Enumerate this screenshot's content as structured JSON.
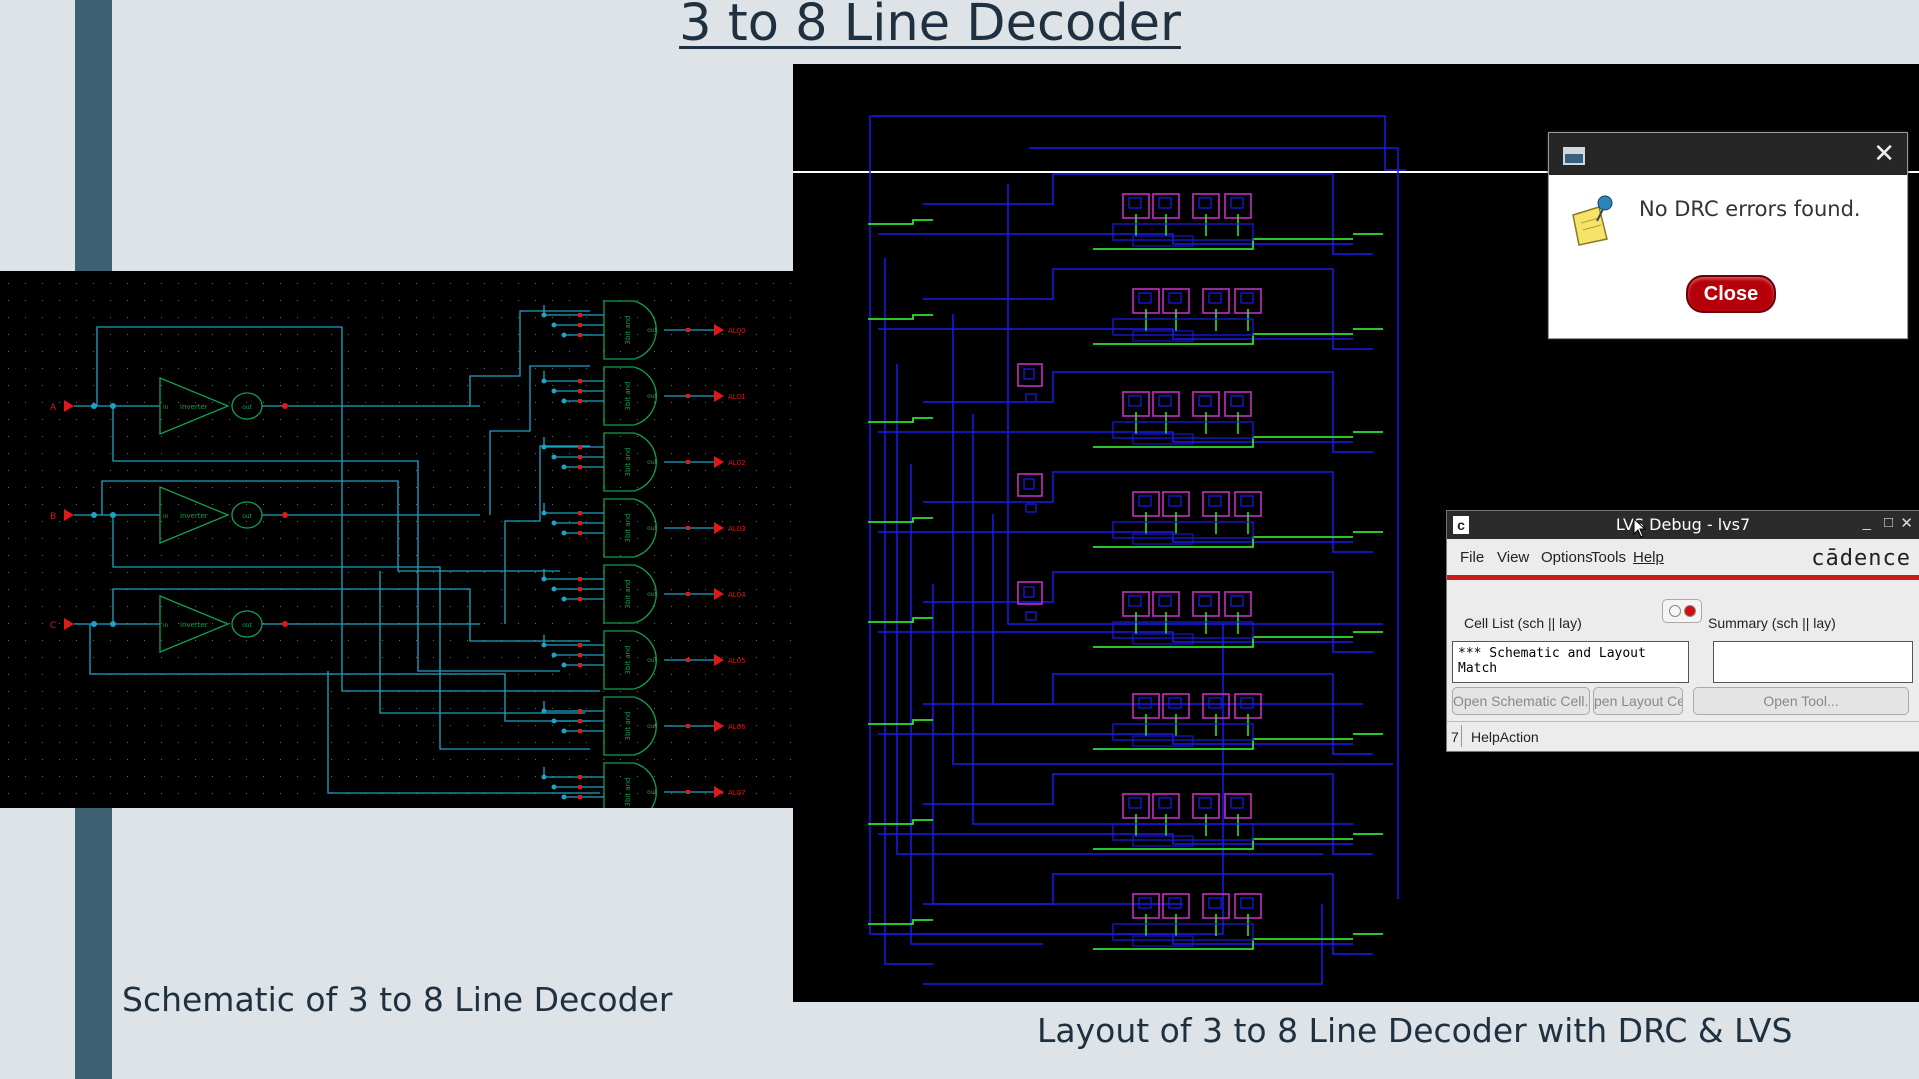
{
  "slide": {
    "title": "3 to 8 Line Decoder",
    "caption_left": "Schematic of 3 to 8 Line Decoder",
    "caption_right": "Layout of 3 to 8 Line Decoder with DRC & LVS"
  },
  "schematic": {
    "inputs": [
      "A",
      "B",
      "C"
    ],
    "inverter_label": "inverter",
    "inverter_pin_in": "in",
    "inverter_pin_out": "out",
    "gate_label": "3bit and",
    "gate_pin_out": "out",
    "outputs": [
      "AL00",
      "AL01",
      "AL02",
      "AL03",
      "AL04",
      "AL05",
      "AL06",
      "AL07"
    ]
  },
  "drc_dialog": {
    "message": "No DRC errors found.",
    "close_label": "Close"
  },
  "lvs_window": {
    "title": "LVS Debug - lvs7",
    "menu": [
      "File",
      "View",
      "Options",
      "Tools",
      "Help"
    ],
    "brand": "cādence",
    "cell_list_label": "Cell List (sch || lay)",
    "summary_label": "Summary (sch || lay)",
    "cell_list_text": "*** Schematic and Layout Match",
    "summary_text": "",
    "buttons": [
      "Open Schematic Cell...",
      "pen Layout Cel",
      "Open Tool..."
    ],
    "status_number": "7",
    "status_text": "HelpAction"
  },
  "colors": {
    "background": "#dde3e7",
    "sidebar": "#3e6073",
    "wire_schematic": "#1fa3c4",
    "symbol_green": "#10a050",
    "pin_red": "#e01818",
    "layout_blue": "#1a1af0",
    "layout_green": "#30e030",
    "layout_magenta": "#c030c0",
    "close_button": "#b5000a",
    "cadence_red": "#c91a1a"
  }
}
